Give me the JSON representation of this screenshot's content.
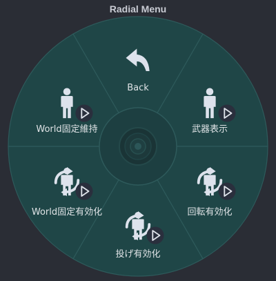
{
  "window": {
    "title": "Radial Menu"
  },
  "menu": {
    "items": [
      {
        "label": "Back",
        "icon": "back-arrow-icon",
        "has_submenu": false
      },
      {
        "label": "武器表示",
        "icon": "person-icon",
        "has_submenu": true
      },
      {
        "label": "回転有効化",
        "icon": "person-rotate-icon",
        "has_submenu": true
      },
      {
        "label": "投げ有効化",
        "icon": "person-rotate-icon",
        "has_submenu": true
      },
      {
        "label": "World固定有効化",
        "icon": "person-rotate-icon",
        "has_submenu": true
      },
      {
        "label": "World固定維持",
        "icon": "person-icon",
        "has_submenu": true
      }
    ]
  },
  "colors": {
    "background": "#2a2d35",
    "segment": "#1f4647",
    "segment_border": "#2e5a5b",
    "hub": "#1d3f41",
    "icon": "#dde2ec"
  }
}
